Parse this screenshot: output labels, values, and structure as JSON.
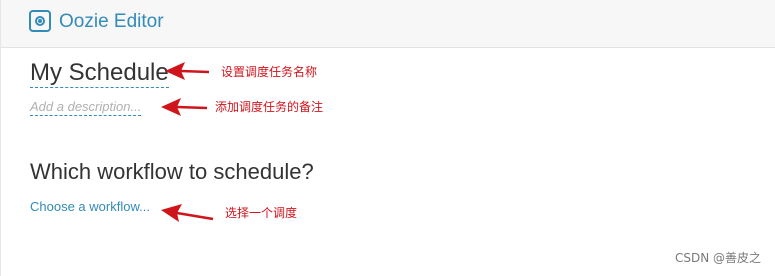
{
  "header": {
    "icon": "oozie-schedule-icon",
    "title": "Oozie Editor"
  },
  "editor": {
    "schedule_name": "My Schedule",
    "description_placeholder": "Add a description...",
    "workflow_heading": "Which workflow to schedule?",
    "choose_workflow_link": "Choose a workflow..."
  },
  "annotations": {
    "name_note": "设置调度任务名称",
    "description_note": "添加调度任务的备注",
    "workflow_note": "选择一个调度",
    "color": "#d0141c"
  },
  "watermark": "CSDN @善皮之",
  "colors": {
    "accent": "#338bb8",
    "header_bg": "#f7f7f7",
    "annotation_red": "#d0141c"
  }
}
